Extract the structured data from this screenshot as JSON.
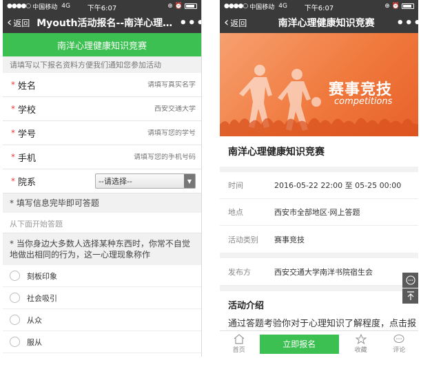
{
  "left": {
    "status": {
      "signal": "●●●●○",
      "carrier": "中国移动",
      "network": "4G",
      "time": "下午6:07"
    },
    "nav": {
      "back_label": "返回",
      "title": "Myouth活动报名--南洋心理…",
      "more": "•••"
    },
    "header": "南洋心理健康知识竞赛",
    "notice": "请填写以下报名资料方便我们通知您参加活动",
    "fields": [
      {
        "label": "姓名",
        "placeholder": "请填写真实名字"
      },
      {
        "label": "学校",
        "placeholder": "西安交通大学"
      },
      {
        "label": "学号",
        "placeholder": "请填写您的学号"
      },
      {
        "label": "手机",
        "placeholder": "请填写您的手机号码"
      }
    ],
    "department": {
      "label": "院系",
      "selected": "--请选择--"
    },
    "section_head": "* 填写信息完毕即可答题",
    "sub_note": "从下面开始答题",
    "question": "* 当你身边大多数人选择某种东西时，你常不自觉地做出相同的行为，这一心理现象称作",
    "options": [
      "刻板印象",
      "社会吸引",
      "从众",
      "服从"
    ]
  },
  "right": {
    "status": {
      "signal": "●●●●○",
      "carrier": "中国移动",
      "network": "4G",
      "time": "下午6:07"
    },
    "nav": {
      "back_label": "返回",
      "title": "南洋心理健康知识竞赛",
      "more": "•••"
    },
    "banner": {
      "title": "赛事竞技",
      "subtitle": "competitions"
    },
    "event_title": "南洋心理健康知识竞赛",
    "info": [
      {
        "label": "时间",
        "value": "2016-05-22 22:00 至 05-25 00:00"
      },
      {
        "label": "地点",
        "value": "西安市全部地区·网上答题"
      },
      {
        "label": "活动类别",
        "value": "赛事竞技"
      }
    ],
    "organizer": {
      "label": "发布方",
      "value": "西安交通大学南洋书院宿生会"
    },
    "intro_head": "活动介绍",
    "intro_text": "通过答题考验你对于心理知识了解程度，点击报",
    "bottom": {
      "home": "首页",
      "signup": "立即报名",
      "favorite": "收藏",
      "comment": "评论"
    }
  },
  "colors": {
    "green": "#3cc051",
    "orange": "#f07a3e",
    "required": "#e43b3b",
    "topbar": "#3a3a3a"
  },
  "icons": [
    "back-chevron-icon",
    "more-icon",
    "radio-icon",
    "home-icon",
    "star-icon",
    "comment-icon",
    "back-to-top-icon",
    "message-icon",
    "dropdown-arrow-icon"
  ]
}
